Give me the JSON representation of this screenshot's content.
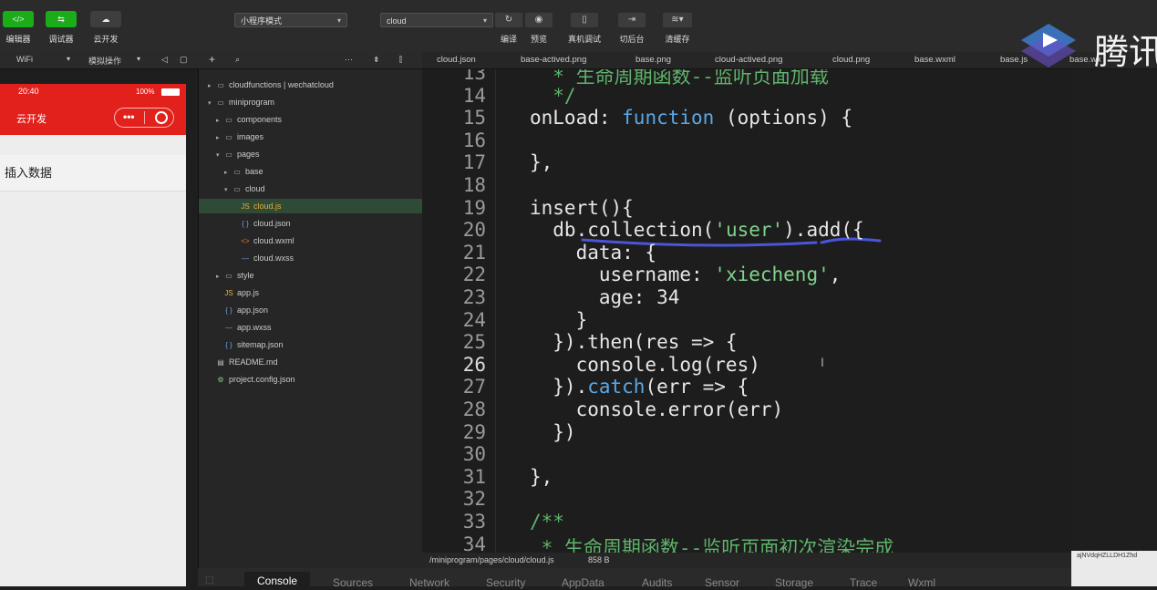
{
  "toolbar": {
    "editor_label": "编辑器",
    "debugger_label": "调试器",
    "cloud_label": "云开发",
    "mode_select": "小程序模式",
    "compile_select": "cloud",
    "compile_label": "编译",
    "preview_label": "预览",
    "device_debug_label": "真机调试",
    "background_label": "切后台",
    "clear_cache_label": "清缓存"
  },
  "subbar": {
    "network": "WiFi",
    "simulate_ops": "模拟操作"
  },
  "simulator": {
    "time": "20:40",
    "battery": "100%",
    "nav_title": "云开发",
    "insert_button": "插入数据"
  },
  "tree": [
    {
      "label": "cloudfunctions | wechatcloud",
      "icon": "cloud-folder-icon",
      "depth": 0,
      "expanded": false,
      "type": "folder"
    },
    {
      "label": "miniprogram",
      "icon": "folder-icon",
      "depth": 0,
      "expanded": true,
      "type": "folder"
    },
    {
      "label": "components",
      "icon": "folder-icon",
      "depth": 1,
      "expanded": false,
      "type": "folder"
    },
    {
      "label": "images",
      "icon": "folder-icon",
      "depth": 1,
      "expanded": false,
      "type": "folder"
    },
    {
      "label": "pages",
      "icon": "folder-icon",
      "depth": 1,
      "expanded": true,
      "type": "folder"
    },
    {
      "label": "base",
      "icon": "folder-icon",
      "depth": 2,
      "expanded": false,
      "type": "folder"
    },
    {
      "label": "cloud",
      "icon": "folder-icon",
      "depth": 2,
      "expanded": true,
      "type": "folder"
    },
    {
      "label": "cloud.js",
      "icon": "js-file-icon",
      "depth": 3,
      "type": "js",
      "selected": true
    },
    {
      "label": "cloud.json",
      "icon": "json-file-icon",
      "depth": 3,
      "type": "json"
    },
    {
      "label": "cloud.wxml",
      "icon": "wxml-file-icon",
      "depth": 3,
      "type": "wxml"
    },
    {
      "label": "cloud.wxss",
      "icon": "wxss-file-icon",
      "depth": 3,
      "type": "wxss"
    },
    {
      "label": "style",
      "icon": "folder-icon",
      "depth": 1,
      "expanded": false,
      "type": "folder"
    },
    {
      "label": "app.js",
      "icon": "js-file-icon",
      "depth": 1,
      "type": "js"
    },
    {
      "label": "app.json",
      "icon": "json-file-icon",
      "depth": 1,
      "type": "json"
    },
    {
      "label": "app.wxss",
      "icon": "wxss-file-icon",
      "depth": 1,
      "type": "wxss"
    },
    {
      "label": "sitemap.json",
      "icon": "json-file-icon",
      "depth": 1,
      "type": "json"
    },
    {
      "label": "README.md",
      "icon": "md-file-icon",
      "depth": 0,
      "type": "md"
    },
    {
      "label": "project.config.json",
      "icon": "config-file-icon",
      "depth": 0,
      "type": "config"
    }
  ],
  "tabs": [
    "cloud.json",
    "base-actived.png",
    "base.png",
    "cloud-actived.png",
    "cloud.png",
    "base.wxml",
    "base.js",
    "base.wx"
  ],
  "code": [
    {
      "n": "13",
      "parts": [
        {
          "t": "  * 生命周期函数--监听页面加载",
          "c": "cm"
        }
      ]
    },
    {
      "n": "14",
      "parts": [
        {
          "t": "  */",
          "c": "cm"
        }
      ]
    },
    {
      "n": "15",
      "parts": [
        {
          "t": "onLoad: ",
          "c": ""
        },
        {
          "t": "function",
          "c": "kw"
        },
        {
          "t": " (options) {",
          "c": ""
        }
      ]
    },
    {
      "n": "16",
      "parts": []
    },
    {
      "n": "17",
      "parts": [
        {
          "t": "},",
          "c": ""
        }
      ]
    },
    {
      "n": "18",
      "parts": []
    },
    {
      "n": "19",
      "parts": [
        {
          "t": "insert(){",
          "c": ""
        }
      ]
    },
    {
      "n": "20",
      "parts": [
        {
          "t": "  db.collection(",
          "c": ""
        },
        {
          "t": "'user'",
          "c": "str"
        },
        {
          "t": ").add({",
          "c": ""
        }
      ]
    },
    {
      "n": "21",
      "parts": [
        {
          "t": "    data: {",
          "c": ""
        }
      ]
    },
    {
      "n": "22",
      "parts": [
        {
          "t": "      username: ",
          "c": ""
        },
        {
          "t": "'xiecheng'",
          "c": "str"
        },
        {
          "t": ",",
          "c": ""
        }
      ]
    },
    {
      "n": "23",
      "parts": [
        {
          "t": "      age: 34",
          "c": ""
        }
      ]
    },
    {
      "n": "24",
      "parts": [
        {
          "t": "    }",
          "c": ""
        }
      ]
    },
    {
      "n": "25",
      "parts": [
        {
          "t": "  }).then(res => {",
          "c": ""
        }
      ]
    },
    {
      "n": "26",
      "parts": [
        {
          "t": "    console.log(res)",
          "c": ""
        }
      ]
    },
    {
      "n": "27",
      "parts": [
        {
          "t": "  }).",
          "c": ""
        },
        {
          "t": "catch",
          "c": "kw"
        },
        {
          "t": "(err => {",
          "c": ""
        }
      ]
    },
    {
      "n": "28",
      "parts": [
        {
          "t": "    console.error(err)",
          "c": ""
        }
      ]
    },
    {
      "n": "29",
      "parts": [
        {
          "t": "  })",
          "c": ""
        }
      ]
    },
    {
      "n": "30",
      "parts": []
    },
    {
      "n": "31",
      "parts": [
        {
          "t": "},",
          "c": ""
        }
      ]
    },
    {
      "n": "32",
      "parts": []
    },
    {
      "n": "33",
      "parts": [
        {
          "t": "/**",
          "c": "cm"
        }
      ]
    },
    {
      "n": "34",
      "parts": [
        {
          "t": " * 生命周期函数--监听页面初次渲染完成",
          "c": "cm"
        }
      ]
    }
  ],
  "statusbar": {
    "path": "/miniprogram/pages/cloud/cloud.js",
    "size": "858 B"
  },
  "devtools_tabs": [
    "Console",
    "Sources",
    "Network",
    "Security",
    "AppData",
    "Audits",
    "Sensor",
    "Storage",
    "Trace",
    "Wxml"
  ],
  "right_panel_text": "ajNVdqHZLLDH1Zhd",
  "watermark": "腾讯"
}
